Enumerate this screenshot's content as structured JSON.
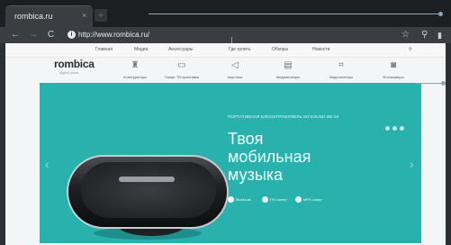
{
  "browser": {
    "tab": {
      "title": "rombica.ru",
      "close_icon": "×"
    },
    "new_tab_icon": "+",
    "nav": {
      "back": "←",
      "forward": "→",
      "reload": "C"
    },
    "address": {
      "info_icon": "i",
      "url": "http://www.rombica.ru/"
    },
    "toolbar_icons": [
      "star-icon",
      "search-icon",
      "menu-icon"
    ]
  },
  "site": {
    "top_links": [
      "Главная",
      "Медиа",
      "Аксессуары",
      "Где купить",
      "Обзоры",
      "Новости"
    ],
    "logo": "rombica",
    "logo_sub": "digital yours",
    "categories": [
      {
        "label": "Конструкторы",
        "icon": "robot-icon"
      },
      {
        "label": "Смарт ТВ приставки",
        "icon": "tv-icon"
      },
      {
        "label": "Акустика",
        "icon": "speaker-icon"
      },
      {
        "label": "Медиаплееры",
        "icon": "player-icon"
      },
      {
        "label": "Видеоплееры",
        "icon": "video-icon"
      },
      {
        "label": "Фотокамеры",
        "icon": "camera-icon"
      }
    ],
    "hero": {
      "tag": "ПОРТАТИВНАЯ БЛЮЗУПРАВЛЯЕЛЬ MYSOUND BE-04",
      "headline": [
        "Твоя",
        "мобильная",
        "музыка"
      ],
      "bullets": [
        "Bluetooth",
        "FM-тюнер",
        "MP3 плеер"
      ],
      "prev_icon": "‹",
      "next_icon": "›"
    }
  },
  "colors": {
    "hero_bg": "#29b2ad",
    "chrome_bg": "#2b2e33"
  }
}
